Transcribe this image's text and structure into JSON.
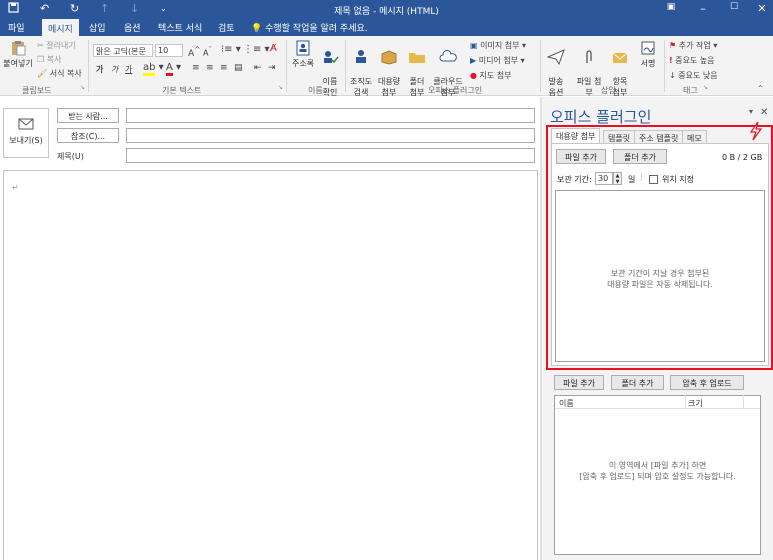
{
  "window": {
    "title": "제목 없음 - 메시지 (HTML)"
  },
  "ribbon_tabs": {
    "file": "파일",
    "message": "메시지",
    "insert": "삽입",
    "options": "옵션",
    "format_text": "텍스트 서식",
    "review": "검토",
    "tell_me": "수행할 작업을 알려 주세요."
  },
  "clipboard": {
    "paste": "붙여넣기",
    "cut": "잘라내기",
    "copy": "복사",
    "format_painter": "서식 복사",
    "group": "클립보드"
  },
  "basic_text": {
    "font": "맑은 고딕(본문",
    "size": "10",
    "bold": "가",
    "italic": "가",
    "underline": "가",
    "group": "기본 텍스트"
  },
  "names": {
    "address_book": "주소록",
    "check_names": "이름\n확인",
    "group": "이름"
  },
  "office_plugin_group": {
    "org_search": "조직도\n검색",
    "large_attach": "대용량\n첨부",
    "folder": "폴더\n첨부",
    "cloud": "클라우드\n첨부",
    "image_attach": "이미지 첨부",
    "media_attach": "미디어 첨부",
    "map_attach": "지도 첨부",
    "group": "오피스 플러그인"
  },
  "include": {
    "send_options": "발송\n옵션",
    "attach_file": "파일 첨\n부",
    "attach_item": "항목\n첨부",
    "signature": "서명",
    "group": "삽입"
  },
  "tags": {
    "follow_up": "추가 작업",
    "high_importance": "중요도 높음",
    "low_importance": "중요도 낮음",
    "group": "태그"
  },
  "compose": {
    "send": "보내기(S)",
    "to": "받는 사람...",
    "cc": "참조(C)...",
    "subject": "제목(U)"
  },
  "pane": {
    "title": "오피스 플러그인",
    "tabs": [
      "대용량 첨부",
      "템플릿",
      "주소 템플릿",
      "메모"
    ],
    "add_file": "파일 추가",
    "add_folder": "폴더 추가",
    "usage": "0 B / 2 GB",
    "retention_label": "보관 기간:",
    "retention_value": "30",
    "retention_unit": "일",
    "location_label": "위치 지정",
    "large_dz_line1": "보관 기간이 지날 경우 첨부된",
    "large_dz_line2": "대용량 파일은 자동 삭제됩니다.",
    "compress_upload": "압축 후 업로드",
    "col_name": "이름",
    "col_size": "크기",
    "list_dz_line1": "이 영역에서 [파일 추가] 하면",
    "list_dz_line2": "[압축 후 업로드] 되며 암호 설정도 가능합니다."
  },
  "colors": {
    "brand": "#2b579a",
    "highlight_border": "#e81123"
  }
}
